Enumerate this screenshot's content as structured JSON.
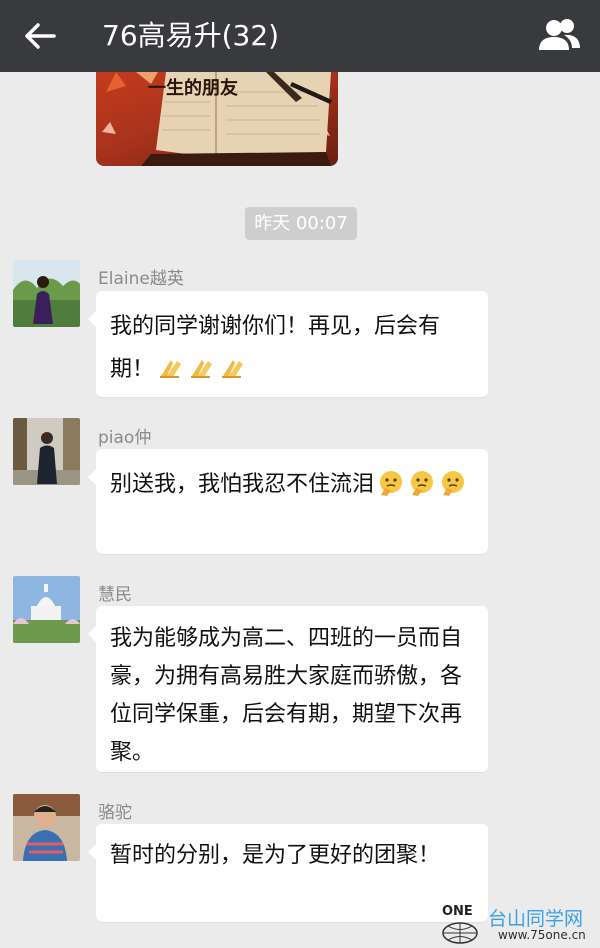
{
  "header": {
    "title": "76高易升(32)",
    "back_icon": "arrow-left-icon",
    "group_icon": "group-members-icon"
  },
  "shared_image": {
    "caption": "一生的朋友"
  },
  "timestamp": "昨天 00:07",
  "messages": [
    {
      "sender": "Elaine越英",
      "text": "我的同学谢谢你们！再见，后会有期！",
      "emoji": "clapping-hands-icon",
      "emoji_count": 3
    },
    {
      "sender": "piao仲",
      "text": "别送我，我怕我忍不住流泪",
      "emoji": "thinking-face-icon",
      "emoji_count": 3
    },
    {
      "sender": "慧民",
      "text": "我为能够成为高二、四班的一员而自豪，为拥有高易胜大家庭而骄傲，各位同学保重，后会有期，期望下次再聚。"
    },
    {
      "sender": "骆驼",
      "text": "暂时的分别，是为了更好的团聚！"
    }
  ],
  "watermark": {
    "logo": "ONE",
    "name": "台山同学网",
    "url": "www.75one.cn"
  },
  "colors": {
    "topbar": "#393a3e",
    "background": "#ebebeb",
    "bubble": "#ffffff",
    "timestamp_pill": "#cecece",
    "sender_name": "#8a8a8a"
  }
}
